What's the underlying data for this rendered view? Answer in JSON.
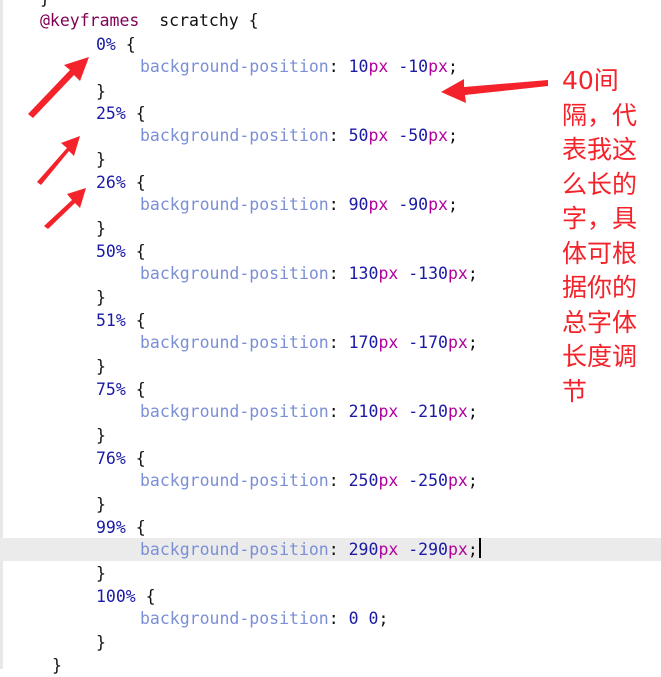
{
  "code": {
    "lines": [
      {
        "parts": [
          {
            "c": "tok-punc",
            "t": "}"
          }
        ]
      },
      {
        "parts": [
          {
            "c": "tok-at",
            "t": "@keyframes"
          },
          {
            "c": "tok-name",
            "t": "  scratchy {"
          }
        ]
      },
      {
        "parts": [
          {
            "c": "tok-sel",
            "t": "0%"
          },
          {
            "c": "tok-punc",
            "t": " {"
          }
        ]
      },
      {
        "parts": [
          {
            "c": "tok-prop",
            "t": "background-position"
          },
          {
            "c": "tok-punc",
            "t": ": "
          },
          {
            "c": "tok-num",
            "t": "10"
          },
          {
            "c": "tok-unit",
            "t": "px"
          },
          {
            "c": "tok-punc",
            "t": " "
          },
          {
            "c": "tok-num",
            "t": "-10"
          },
          {
            "c": "tok-unit",
            "t": "px"
          },
          {
            "c": "tok-punc",
            "t": ";"
          }
        ]
      },
      {
        "parts": [
          {
            "c": "tok-punc",
            "t": "}"
          }
        ]
      },
      {
        "parts": [
          {
            "c": "tok-sel",
            "t": "25%"
          },
          {
            "c": "tok-punc",
            "t": " {"
          }
        ]
      },
      {
        "parts": [
          {
            "c": "tok-prop",
            "t": "background-position"
          },
          {
            "c": "tok-punc",
            "t": ": "
          },
          {
            "c": "tok-num",
            "t": "50"
          },
          {
            "c": "tok-unit",
            "t": "px"
          },
          {
            "c": "tok-punc",
            "t": " "
          },
          {
            "c": "tok-num",
            "t": "-50"
          },
          {
            "c": "tok-unit",
            "t": "px"
          },
          {
            "c": "tok-punc",
            "t": ";"
          }
        ]
      },
      {
        "parts": [
          {
            "c": "tok-punc",
            "t": "}"
          }
        ]
      },
      {
        "parts": [
          {
            "c": "tok-sel",
            "t": "26%"
          },
          {
            "c": "tok-punc",
            "t": " {"
          }
        ]
      },
      {
        "parts": [
          {
            "c": "tok-prop",
            "t": "background-position"
          },
          {
            "c": "tok-punc",
            "t": ": "
          },
          {
            "c": "tok-num",
            "t": "90"
          },
          {
            "c": "tok-unit",
            "t": "px"
          },
          {
            "c": "tok-punc",
            "t": " "
          },
          {
            "c": "tok-num",
            "t": "-90"
          },
          {
            "c": "tok-unit",
            "t": "px"
          },
          {
            "c": "tok-punc",
            "t": ";"
          }
        ]
      },
      {
        "parts": [
          {
            "c": "tok-punc",
            "t": "}"
          }
        ]
      },
      {
        "parts": [
          {
            "c": "tok-sel",
            "t": "50%"
          },
          {
            "c": "tok-punc",
            "t": " {"
          }
        ]
      },
      {
        "parts": [
          {
            "c": "tok-prop",
            "t": "background-position"
          },
          {
            "c": "tok-punc",
            "t": ": "
          },
          {
            "c": "tok-num",
            "t": "130"
          },
          {
            "c": "tok-unit",
            "t": "px"
          },
          {
            "c": "tok-punc",
            "t": " "
          },
          {
            "c": "tok-num",
            "t": "-130"
          },
          {
            "c": "tok-unit",
            "t": "px"
          },
          {
            "c": "tok-punc",
            "t": ";"
          }
        ]
      },
      {
        "parts": [
          {
            "c": "tok-punc",
            "t": "}"
          }
        ]
      },
      {
        "parts": [
          {
            "c": "tok-sel",
            "t": "51%"
          },
          {
            "c": "tok-punc",
            "t": " {"
          }
        ]
      },
      {
        "parts": [
          {
            "c": "tok-prop",
            "t": "background-position"
          },
          {
            "c": "tok-punc",
            "t": ": "
          },
          {
            "c": "tok-num",
            "t": "170"
          },
          {
            "c": "tok-unit",
            "t": "px"
          },
          {
            "c": "tok-punc",
            "t": " "
          },
          {
            "c": "tok-num",
            "t": "-170"
          },
          {
            "c": "tok-unit",
            "t": "px"
          },
          {
            "c": "tok-punc",
            "t": ";"
          }
        ]
      },
      {
        "parts": [
          {
            "c": "tok-punc",
            "t": "}"
          }
        ]
      },
      {
        "parts": [
          {
            "c": "tok-sel",
            "t": "75%"
          },
          {
            "c": "tok-punc",
            "t": " {"
          }
        ]
      },
      {
        "parts": [
          {
            "c": "tok-prop",
            "t": "background-position"
          },
          {
            "c": "tok-punc",
            "t": ": "
          },
          {
            "c": "tok-num",
            "t": "210"
          },
          {
            "c": "tok-unit",
            "t": "px"
          },
          {
            "c": "tok-punc",
            "t": " "
          },
          {
            "c": "tok-num",
            "t": "-210"
          },
          {
            "c": "tok-unit",
            "t": "px"
          },
          {
            "c": "tok-punc",
            "t": ";"
          }
        ]
      },
      {
        "parts": [
          {
            "c": "tok-punc",
            "t": "}"
          }
        ]
      },
      {
        "parts": [
          {
            "c": "tok-sel",
            "t": "76%"
          },
          {
            "c": "tok-punc",
            "t": " {"
          }
        ]
      },
      {
        "parts": [
          {
            "c": "tok-prop",
            "t": "background-position"
          },
          {
            "c": "tok-punc",
            "t": ": "
          },
          {
            "c": "tok-num",
            "t": "250"
          },
          {
            "c": "tok-unit",
            "t": "px"
          },
          {
            "c": "tok-punc",
            "t": " "
          },
          {
            "c": "tok-num",
            "t": "-250"
          },
          {
            "c": "tok-unit",
            "t": "px"
          },
          {
            "c": "tok-punc",
            "t": ";"
          }
        ]
      },
      {
        "parts": [
          {
            "c": "tok-punc",
            "t": "}"
          }
        ]
      },
      {
        "parts": [
          {
            "c": "tok-sel",
            "t": "99%"
          },
          {
            "c": "tok-punc",
            "t": " {"
          }
        ]
      },
      {
        "parts": [
          {
            "c": "tok-prop",
            "t": "background-position"
          },
          {
            "c": "tok-punc",
            "t": ": "
          },
          {
            "c": "tok-num",
            "t": "290"
          },
          {
            "c": "tok-unit",
            "t": "px"
          },
          {
            "c": "tok-punc",
            "t": " "
          },
          {
            "c": "tok-num",
            "t": "-290"
          },
          {
            "c": "tok-unit",
            "t": "px"
          },
          {
            "c": "tok-punc",
            "t": ";"
          }
        ],
        "current": true
      },
      {
        "parts": [
          {
            "c": "tok-punc",
            "t": "}"
          }
        ]
      },
      {
        "parts": [
          {
            "c": "tok-sel",
            "t": "100%"
          },
          {
            "c": "tok-punc",
            "t": " {"
          }
        ]
      },
      {
        "parts": [
          {
            "c": "tok-prop",
            "t": "background-position"
          },
          {
            "c": "tok-punc",
            "t": ": "
          },
          {
            "c": "tok-num",
            "t": "0"
          },
          {
            "c": "tok-punc",
            "t": " "
          },
          {
            "c": "tok-num",
            "t": "0"
          },
          {
            "c": "tok-punc",
            "t": ";"
          }
        ]
      },
      {
        "parts": [
          {
            "c": "tok-punc",
            "t": "}"
          }
        ]
      },
      {
        "parts": [
          {
            "c": "tok-punc",
            "t": "}"
          }
        ]
      }
    ]
  },
  "annotation": {
    "text": "40间隔，代表我这么长的字，具体可根据你的总字体长度调节",
    "color": "#f4232b"
  },
  "colors": {
    "current_line": "#ebebeb",
    "arrow": "#f4232b"
  }
}
